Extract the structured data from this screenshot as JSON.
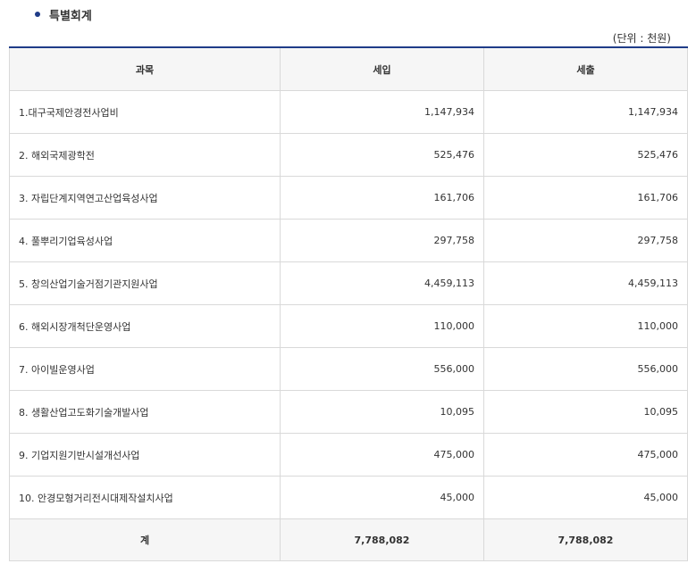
{
  "heading": "특별회계",
  "unit": "(단위 : 천원)",
  "headers": {
    "subject": "과목",
    "revenue": "세입",
    "expenditure": "세출"
  },
  "rows": [
    {
      "subject": "1.대구국제안경전사업비",
      "revenue": "1,147,934",
      "expenditure": "1,147,934"
    },
    {
      "subject": "2. 해외국제광학전",
      "revenue": "525,476",
      "expenditure": "525,476"
    },
    {
      "subject": "3. 자립단계지역연고산업육성사업",
      "revenue": "161,706",
      "expenditure": "161,706"
    },
    {
      "subject": "4. 풀뿌리기업육성사업",
      "revenue": "297,758",
      "expenditure": "297,758"
    },
    {
      "subject": "5. 창의산업기술거점기관지원사업",
      "revenue": "4,459,113",
      "expenditure": "4,459,113"
    },
    {
      "subject": "6. 해외시장개척단운영사업",
      "revenue": "110,000",
      "expenditure": "110,000"
    },
    {
      "subject": "7. 아이빌운영사업",
      "revenue": "556,000",
      "expenditure": "556,000"
    },
    {
      "subject": "8. 생활산업고도화기술개발사업",
      "revenue": "10,095",
      "expenditure": "10,095"
    },
    {
      "subject": "9. 기업지원기반시설개선사업",
      "revenue": "475,000",
      "expenditure": "475,000"
    },
    {
      "subject": "10. 안경모형거리전시대제작설치사업",
      "revenue": "45,000",
      "expenditure": "45,000"
    }
  ],
  "total": {
    "label": "계",
    "revenue": "7,788,082",
    "expenditure": "7,788,082"
  },
  "colors": {
    "accent": "#1f3c88",
    "header_bg": "#f6f6f6",
    "border": "#d9d9d9"
  }
}
